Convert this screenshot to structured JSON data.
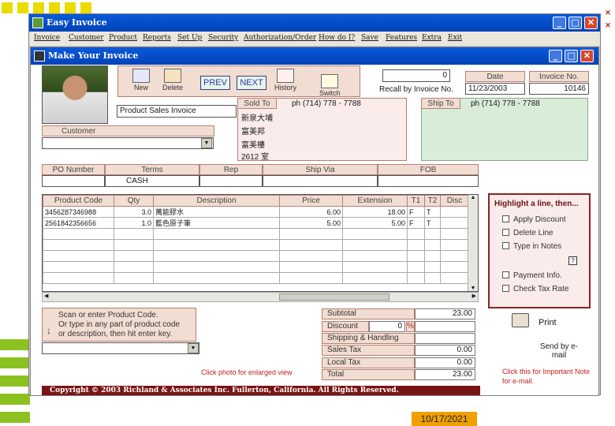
{
  "app": {
    "title": "Easy Invoice",
    "menu": [
      "Invoice",
      "Customer",
      "Product",
      "Reports",
      "Set Up",
      "Security",
      "Authorization/Order",
      "How do I?",
      "Save",
      "Features",
      "Extra",
      "Exit"
    ]
  },
  "invoice_window": {
    "title": "Make Your Invoice",
    "toolbar": {
      "new": "New",
      "delete": "Delete",
      "prev": "PREV",
      "next": "NEXT",
      "history": "History",
      "switch": "Switch"
    },
    "recall_value": "0",
    "recall_label": "Recall by Invoice No.",
    "date_header": "Date",
    "invoice_no_header": "Invoice No.",
    "date_value": "11/23/2003",
    "invoice_no_value": "10146",
    "invoice_type": "Product Sales Invoice",
    "customer_label": "Customer",
    "customer_value": "",
    "sold_to_label": "Sold To",
    "sold_to_phone": "ph (714) 778 - 7788",
    "sold_to_lines": [
      "新泉大埔",
      "富美邦",
      "富美樓",
      "2612 室"
    ],
    "ship_to_label": "Ship To",
    "ship_to_phone": "ph (714) 778 - 7788",
    "po_headers": [
      "PO Number",
      "Terms",
      "Rep",
      "Ship Via",
      "FOB"
    ],
    "po_values": [
      "",
      "CASH",
      "",
      "",
      ""
    ],
    "grid": {
      "headers": [
        "Product Code",
        "Qty",
        "Description",
        "Price",
        "Extension",
        "T1",
        "T2",
        "Disc"
      ],
      "rows": [
        [
          "3456287346988",
          "3.0",
          "萬能膠水",
          "6.00",
          "18.00",
          "F",
          "T",
          ""
        ],
        [
          "2561842356656",
          "1.0",
          "藍色原子筆",
          "5.00",
          "5.00",
          "F",
          "T",
          ""
        ]
      ]
    },
    "highlight": {
      "title": "Highlight a line, then...",
      "options": [
        "Apply Discount",
        "Delete Line",
        "Type in Notes",
        "Payment Info.",
        "Check Tax Rate"
      ]
    },
    "scan_hint": [
      "Scan or enter Product Code.",
      "Or type in any part of product code",
      "or description, then hit enter key."
    ],
    "photo_hint": "Click photo for enlarged view",
    "totals": {
      "subtotal_label": "Subtotal",
      "subtotal": "23.00",
      "discount_label": "Discount",
      "discount_pct": "0",
      "pct_sign": "%",
      "shipping_label": "Shipping & Handling",
      "shipping": "",
      "sales_tax_label": "Sales Tax",
      "sales_tax": "0.00",
      "local_tax_label": "Local Tax",
      "local_tax": "0.00",
      "total_label": "Total",
      "total": "23.00"
    },
    "print_label": "Print",
    "send_email_label": "Send by e-mail",
    "important_note": "Click this for Important Note for e-mail.",
    "copyright": "Copyright © 2003 Richland & Associates Inc. Fullerton, California. All Rights Reserved."
  },
  "slide_date": "10/17/2021",
  "colors": {
    "title_bar": "#0a5ad8",
    "accent_pink": "#f1ddd1",
    "footer": "#7a1414",
    "footer_date": "#f0a000"
  }
}
